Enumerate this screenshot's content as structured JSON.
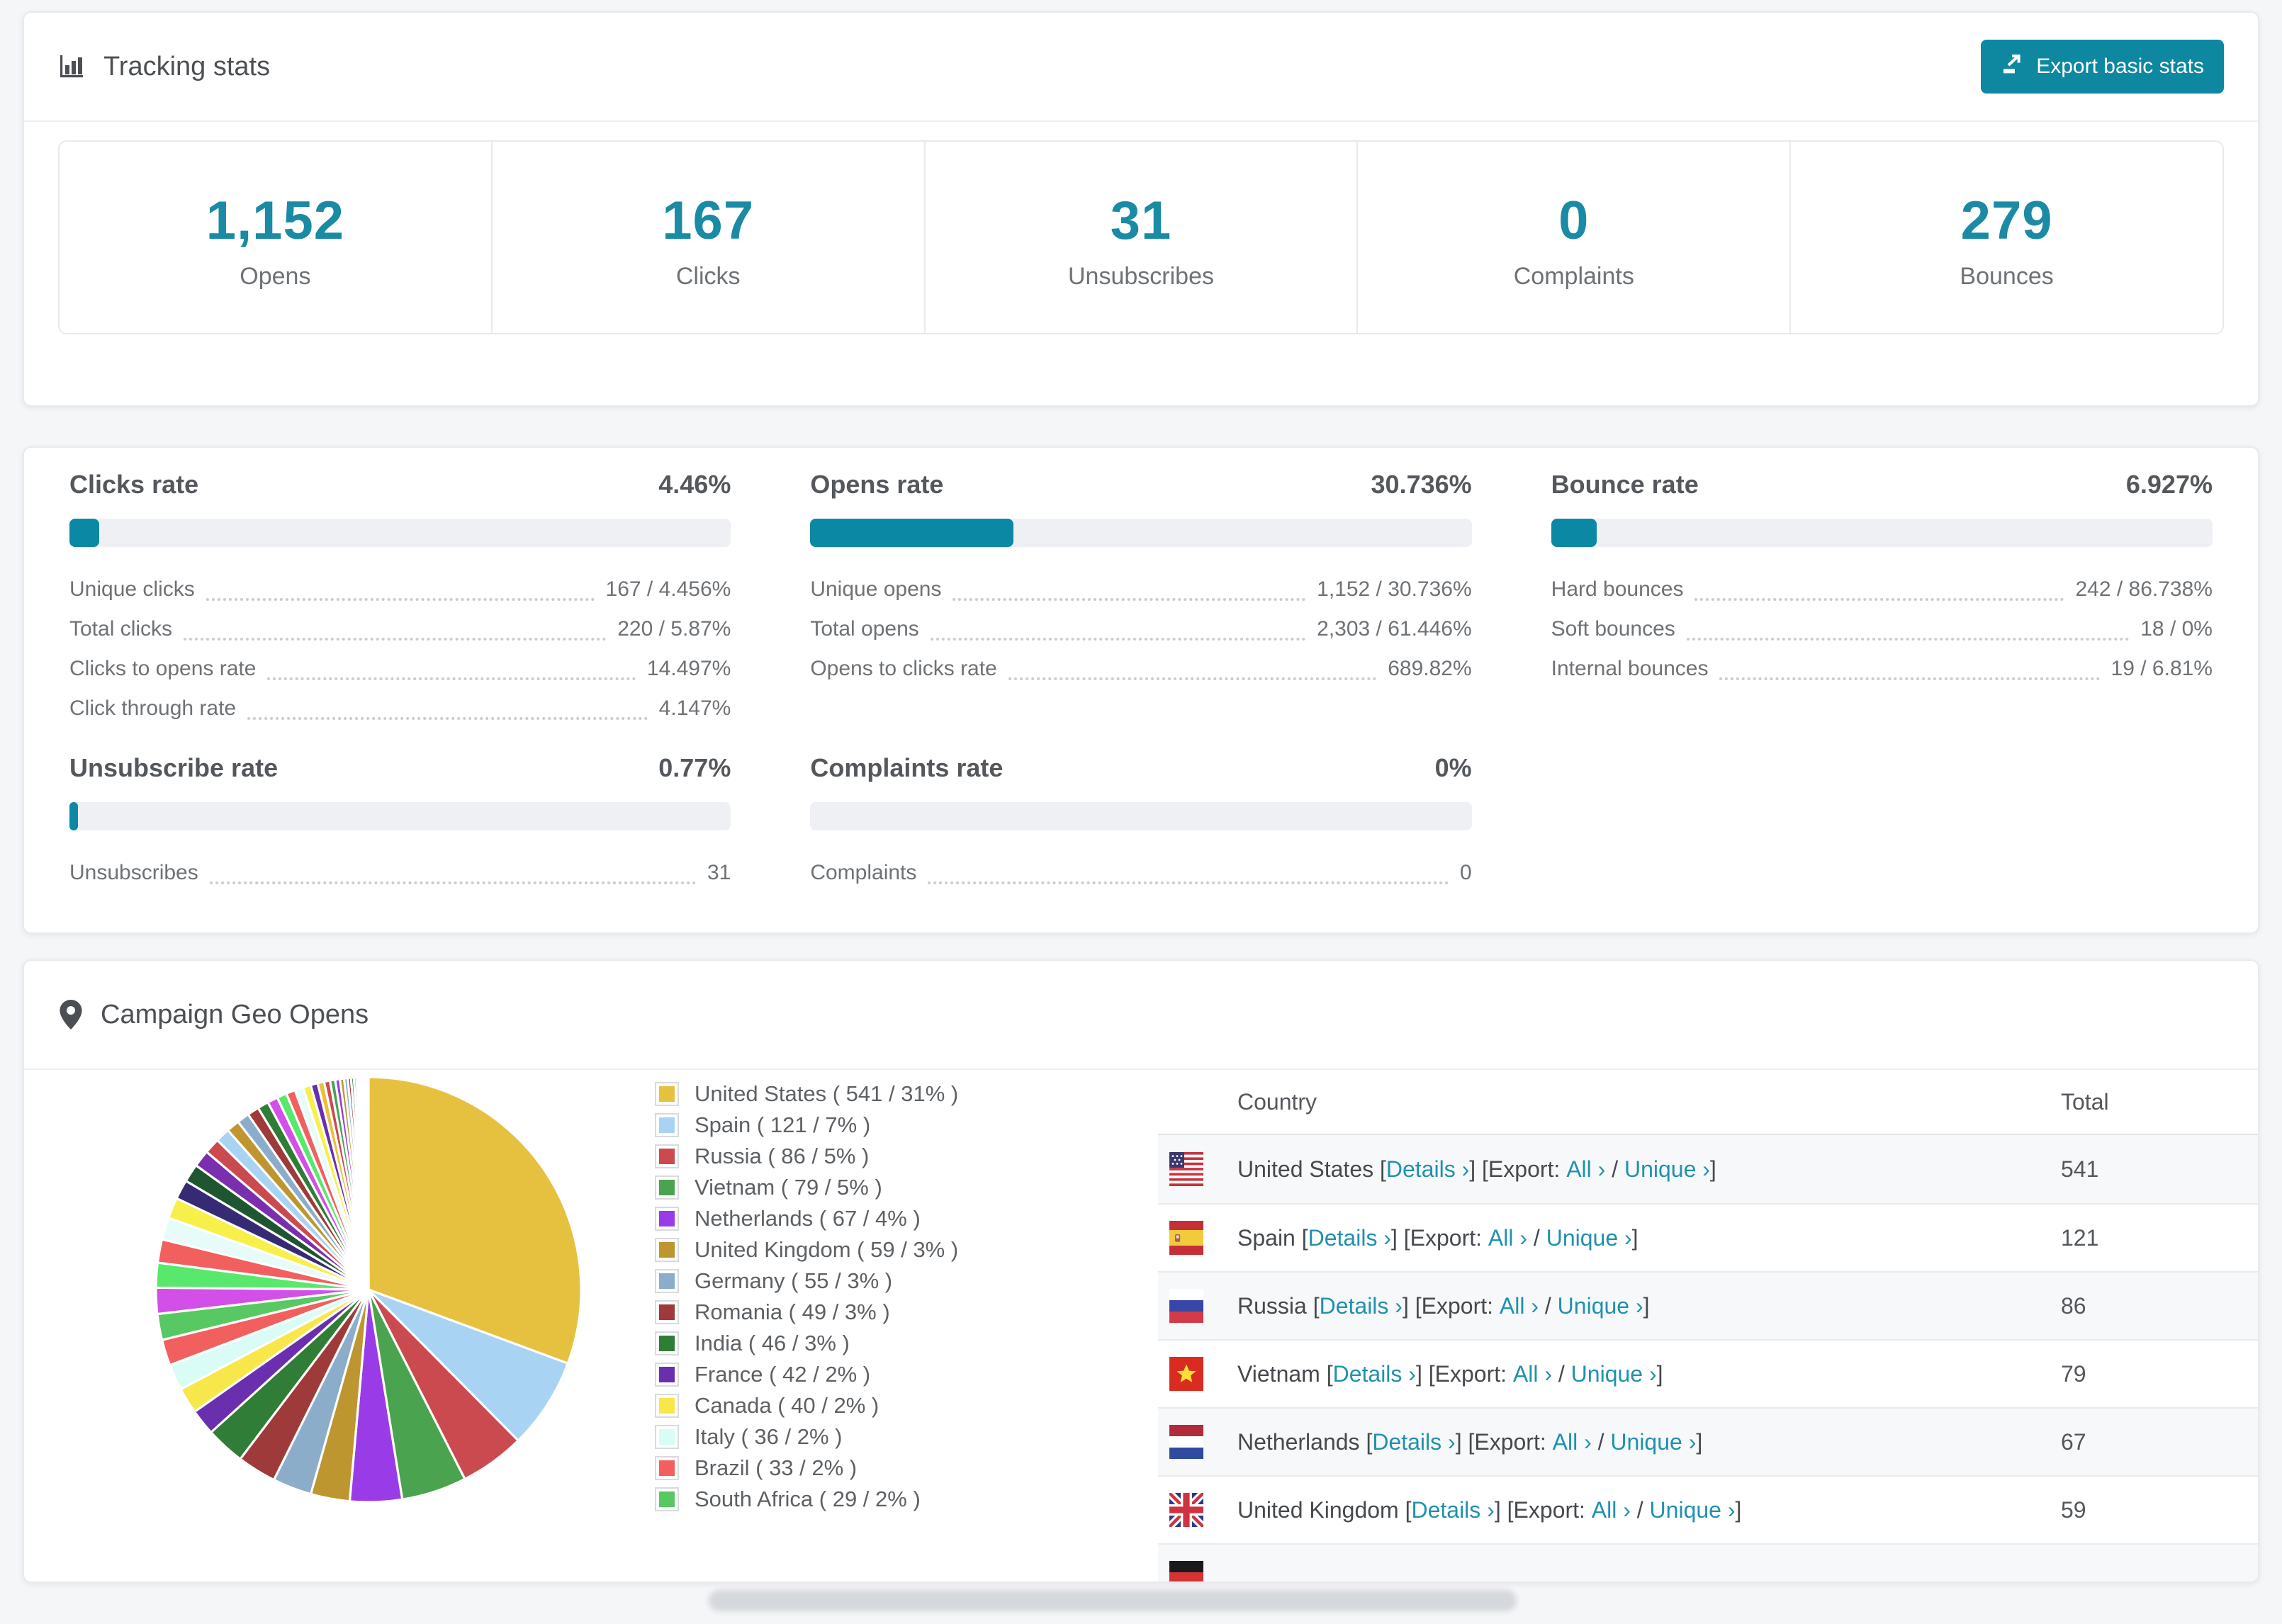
{
  "accent": {
    "teal": "#0e87a0",
    "stat_teal": "#1a8aa5",
    "link_teal": "#2091ad",
    "bar_fill": "#0b89a4",
    "bar_track": "#eef0f3"
  },
  "tracking_stats": {
    "title": "Tracking stats",
    "export_button_label": "Export basic stats",
    "summary_cards": [
      {
        "value": "1,152",
        "label": "Opens"
      },
      {
        "value": "167",
        "label": "Clicks"
      },
      {
        "value": "31",
        "label": "Unsubscribes"
      },
      {
        "value": "0",
        "label": "Complaints"
      },
      {
        "value": "279",
        "label": "Bounces"
      }
    ]
  },
  "rate_sections": [
    {
      "title": "Clicks rate",
      "percent": "4.46%",
      "fill_pct": 4.46,
      "rows": [
        {
          "label": "Unique clicks",
          "value": "167 / 4.456%"
        },
        {
          "label": "Total clicks",
          "value": "220 / 5.87%"
        },
        {
          "label": "Clicks to opens rate",
          "value": "14.497%"
        },
        {
          "label": "Click through rate",
          "value": "4.147%"
        }
      ]
    },
    {
      "title": "Opens rate",
      "percent": "30.736%",
      "fill_pct": 30.736,
      "rows": [
        {
          "label": "Unique opens",
          "value": "1,152 / 30.736%"
        },
        {
          "label": "Total opens",
          "value": "2,303 / 61.446%"
        },
        {
          "label": "Opens to clicks rate",
          "value": "689.82%"
        }
      ]
    },
    {
      "title": "Bounce rate",
      "percent": "6.927%",
      "fill_pct": 6.927,
      "rows": [
        {
          "label": "Hard bounces",
          "value": "242 / 86.738%"
        },
        {
          "label": "Soft bounces",
          "value": "18 / 0%"
        },
        {
          "label": "Internal bounces",
          "value": "19 / 6.81%"
        }
      ]
    },
    {
      "title": "Unsubscribe rate",
      "percent": "0.77%",
      "fill_pct": 0.77,
      "rows": [
        {
          "label": "Unsubscribes",
          "value": "31"
        }
      ]
    },
    {
      "title": "Complaints rate",
      "percent": "0%",
      "fill_pct": 0,
      "rows": [
        {
          "label": "Complaints",
          "value": "0"
        }
      ]
    }
  ],
  "geo": {
    "title": "Campaign Geo Opens",
    "table": {
      "headers": {
        "country": "Country",
        "total": "Total"
      },
      "links": {
        "details": "Details ›",
        "all": "All ›",
        "unique": "Unique ›"
      },
      "rows": [
        {
          "country": "United States",
          "total": "541",
          "flag": "us"
        },
        {
          "country": "Spain",
          "total": "121",
          "flag": "es"
        },
        {
          "country": "Russia",
          "total": "86",
          "flag": "ru"
        },
        {
          "country": "Vietnam",
          "total": "79",
          "flag": "vn"
        },
        {
          "country": "Netherlands",
          "total": "67",
          "flag": "nl"
        },
        {
          "country": "United Kingdom",
          "total": "59",
          "flag": "gb"
        }
      ],
      "partial_row": {
        "flag": "de"
      }
    }
  },
  "chart_data": {
    "type": "pie",
    "title": "Campaign Geo Opens",
    "legend_position": "right-list",
    "slices": [
      {
        "name": "United States",
        "count": 541,
        "percent": 31,
        "color": "#e6c140",
        "legend": "United States ( 541 / 31% )"
      },
      {
        "name": "Spain",
        "count": 121,
        "percent": 7,
        "color": "#a9d3f2",
        "legend": "Spain ( 121 / 7% )"
      },
      {
        "name": "Russia",
        "count": 86,
        "percent": 5,
        "color": "#cb4a50",
        "legend": "Russia ( 86 / 5% )"
      },
      {
        "name": "Vietnam",
        "count": 79,
        "percent": 5,
        "color": "#4aa34f",
        "legend": "Vietnam ( 79 / 5% )"
      },
      {
        "name": "Netherlands",
        "count": 67,
        "percent": 4,
        "color": "#9a3be8",
        "legend": "Netherlands ( 67 / 4% )"
      },
      {
        "name": "United Kingdom",
        "count": 59,
        "percent": 3,
        "color": "#bd9630",
        "legend": "United Kingdom ( 59 / 3% )"
      },
      {
        "name": "Germany",
        "count": 55,
        "percent": 3,
        "color": "#8badc9",
        "legend": "Germany ( 55 / 3% )"
      },
      {
        "name": "Romania",
        "count": 49,
        "percent": 3,
        "color": "#9e3a3a",
        "legend": "Romania ( 49 / 3% )"
      },
      {
        "name": "India",
        "count": 46,
        "percent": 3,
        "color": "#2f7d36",
        "legend": "India ( 46 / 3% )"
      },
      {
        "name": "France",
        "count": 42,
        "percent": 2,
        "color": "#6a2fae",
        "legend": "France ( 42 / 2% )"
      },
      {
        "name": "Canada",
        "count": 40,
        "percent": 2,
        "color": "#f7e74a",
        "legend": "Canada ( 40 / 2% )"
      },
      {
        "name": "Italy",
        "count": 36,
        "percent": 2,
        "color": "#d9fcf6",
        "legend": "Italy ( 36 / 2% )"
      },
      {
        "name": "Brazil",
        "count": 33,
        "percent": 2,
        "color": "#f25f5f",
        "legend": "Brazil ( 33 / 2% )"
      },
      {
        "name": "South Africa",
        "count": 29,
        "percent": 2,
        "color": "#58c862",
        "legend": "South Africa ( 29 / 2% )"
      }
    ],
    "other_slices": {
      "note": "unlabelled small countries fanned out to 12 o'clock",
      "values": [
        2,
        1.9,
        1.8,
        1.7,
        1.6,
        1.5,
        1.4,
        1.3,
        1.2,
        1.1,
        1,
        0.95,
        0.9,
        0.85,
        0.8,
        0.75,
        0.7,
        0.65,
        0.6,
        0.55,
        0.5,
        0.45,
        0.4,
        0.36,
        0.32,
        0.28,
        0.25,
        0.22,
        0.2,
        0.18,
        0.15,
        0.12,
        0.1,
        0.08,
        0.07,
        0.06,
        0.05,
        0.04,
        0.03,
        0.03
      ],
      "colors": [
        "#d24fe8",
        "#58e86b",
        "#f25f5f",
        "#e7fcf8",
        "#f7ef4a",
        "#372a75",
        "#1e5631",
        "#7a2fae",
        "#cb4a50",
        "#a9d3f2",
        "#bd9630",
        "#8badc9",
        "#9e3a3a",
        "#2f7d36",
        "#d24fe8",
        "#58e86b",
        "#f25f5f",
        "#e7fcf8",
        "#f7ef4a",
        "#6a2fae",
        "#e6c140",
        "#cb4a50",
        "#4aa34f",
        "#9a3be8",
        "#bd9630",
        "#8badc9",
        "#9e3a3a",
        "#2f7d36",
        "#d24fe8",
        "#58e86b",
        "#f25f5f",
        "#f7ef4a",
        "#6a2fae",
        "#e6c140",
        "#a9d3f2",
        "#cb4a50",
        "#4aa34f",
        "#9a3be8",
        "#bd9630",
        "#9e3a3a"
      ]
    }
  }
}
